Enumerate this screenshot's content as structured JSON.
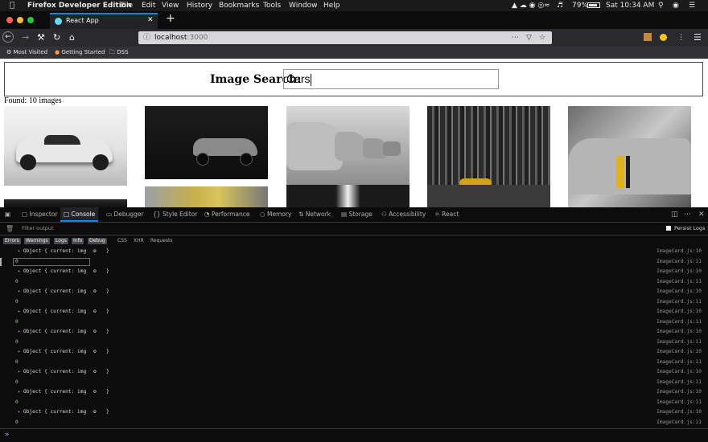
{
  "menubar": {
    "app": "Firefox Developer Edition",
    "menus": [
      "File",
      "Edit",
      "View",
      "History",
      "Bookmarks",
      "Tools",
      "Window",
      "Help"
    ],
    "battery": "79%",
    "clock": "Sat 10:34 AM"
  },
  "browser": {
    "tab_title": "React App",
    "url_host": "localhost",
    "url_port": ":3000",
    "bookmarks": [
      "Most Visited",
      "Getting Started",
      "DSS"
    ]
  },
  "page": {
    "search_label": "Image Search:",
    "search_value": "Cars",
    "found_text": "Found: 10 images"
  },
  "devtools": {
    "tabs": [
      "Inspector",
      "Console",
      "Debugger",
      "Style Editor",
      "Performance",
      "Memory",
      "Network",
      "Storage",
      "Accessibility",
      "React"
    ],
    "active_tab": "Console",
    "filter_placeholder": "Filter output",
    "persist_logs": "Persist Logs",
    "levels": [
      "Errors",
      "Warnings",
      "Logs",
      "Info",
      "Debug"
    ],
    "categories": [
      "CSS",
      "XHR",
      "Requests"
    ],
    "log_object": "Object { current: img ",
    "log_close": "}",
    "log_zero": "0",
    "src_a": "ImageCard.js:10",
    "src_b": "ImageCard.js:11",
    "prompt": "»"
  }
}
